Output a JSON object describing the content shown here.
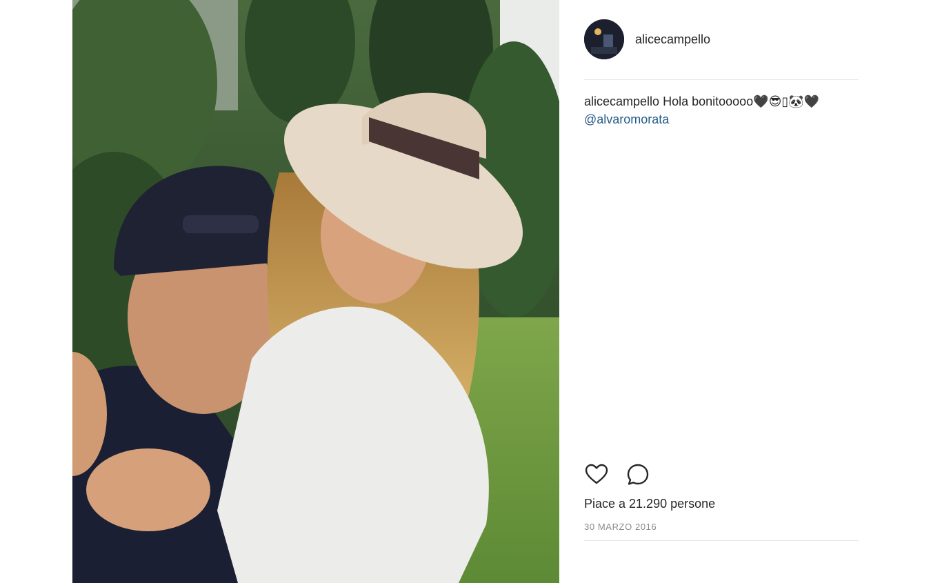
{
  "post": {
    "photo_alt": "selfie",
    "username": "alicecampello",
    "caption": {
      "username": "alicecampello",
      "text": "Hola bonitooooo🖤😎▯🐼🖤",
      "mention": "@alvaromorata"
    },
    "likes_text": "Piace a 21.290 persone",
    "date": "30 MARZO 2016",
    "icons": [
      "heart-icon",
      "comment-icon"
    ]
  }
}
